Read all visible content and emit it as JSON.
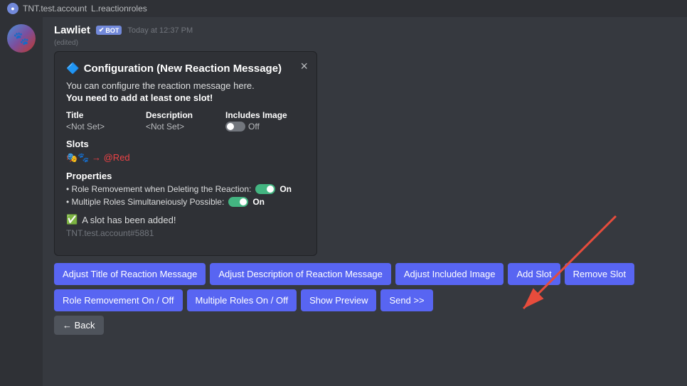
{
  "topbar": {
    "account": "TNT.test.account",
    "channel": "L.reactionroles"
  },
  "message": {
    "username": "Lawliet",
    "bot_label": "BOT",
    "timestamp": "Today at 12:37 PM",
    "edited": "(edited)"
  },
  "card": {
    "title": "⬜ Configuration (New Reaction Message)",
    "title_icon": "🔷",
    "desc1": "You can configure the reaction message here.",
    "desc2": "You need to add at least one slot!",
    "close_icon": "×",
    "table": {
      "headers": [
        "Title",
        "Description",
        "Includes Image"
      ],
      "values": [
        "<Not Set>",
        "<Not Set>",
        ""
      ]
    },
    "toggle_off_label": "Off",
    "slots_title": "Slots",
    "slot_entry": "🎭🐾 → @Red",
    "properties_title": "Properties",
    "prop1_text": "• Role Removement when Deleting the Reaction:",
    "prop1_status": "On",
    "prop2_text": "• Multiple Roles Simultaneiously Possible:",
    "prop2_status": "On",
    "success_msg": "A slot has been added!",
    "user_tag": "TNT.test.account#5881"
  },
  "buttons": {
    "row1": [
      "Adjust Title of Reaction Message",
      "Adjust Description of Reaction Message",
      "Adjust Included Image",
      "Add Slot",
      "Remove Slot"
    ],
    "row2": [
      "Role Removement On / Off",
      "Multiple Roles On / Off",
      "Show Preview",
      "Send >>"
    ],
    "row3": [
      "← Back"
    ]
  },
  "avatar": {
    "emoji": "🐾"
  }
}
